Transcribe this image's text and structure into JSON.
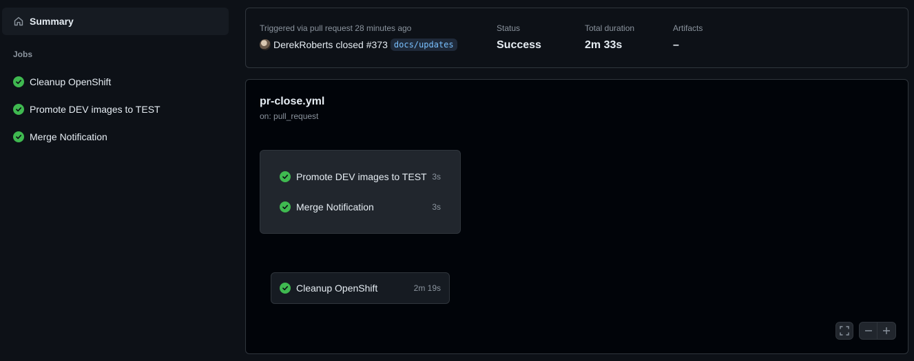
{
  "sidebar": {
    "summary_label": "Summary",
    "jobs_heading": "Jobs",
    "jobs": [
      {
        "label": "Cleanup OpenShift",
        "status": "success"
      },
      {
        "label": "Promote DEV images to TEST",
        "status": "success"
      },
      {
        "label": "Merge Notification",
        "status": "success"
      }
    ]
  },
  "run_summary": {
    "trigger_text": "Triggered via pull request 28 minutes ago",
    "actor": "DerekRoberts",
    "action_text": "closed #373",
    "branch": "docs/updates",
    "status_label": "Status",
    "status_value": "Success",
    "duration_label": "Total duration",
    "duration_value": "2m 33s",
    "artifacts_label": "Artifacts",
    "artifacts_value": "–"
  },
  "workflow": {
    "name": "pr-close.yml",
    "on": "on: pull_request",
    "group_jobs": [
      {
        "label": "Promote DEV images to TEST",
        "duration": "3s"
      },
      {
        "label": "Merge Notification",
        "duration": "3s"
      }
    ],
    "standalone_job": {
      "label": "Cleanup OpenShift",
      "duration": "2m 19s"
    }
  },
  "colors": {
    "success": "#3fb950",
    "background": "#0d1117",
    "panel_border": "#30363d",
    "branch_text": "#79c0ff"
  },
  "icons": {
    "summary": "home-icon",
    "job_status": "check-circle-icon",
    "fullscreen": "fullscreen-icon",
    "zoom_out": "minus-icon",
    "zoom_in": "plus-icon"
  }
}
